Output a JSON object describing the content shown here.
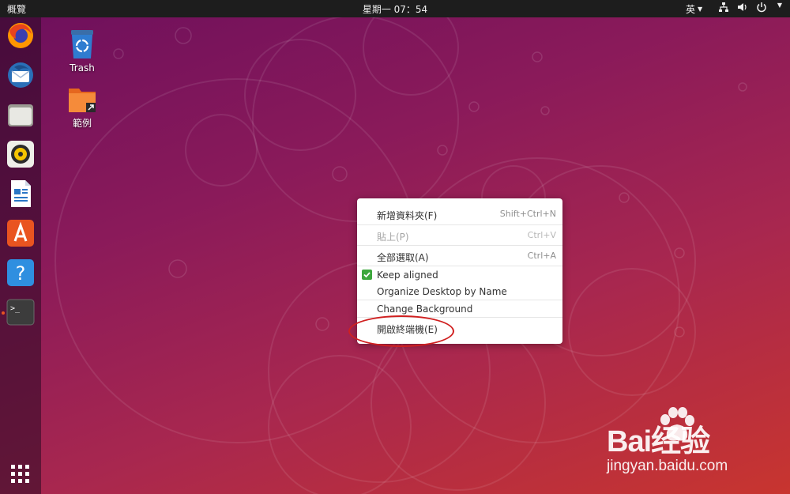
{
  "topbar": {
    "activities_label": "概覽",
    "clock": "星期一 07：54",
    "input_method": "英"
  },
  "dock": {
    "items": [
      {
        "icon": "firefox-icon"
      },
      {
        "icon": "thunderbird-icon"
      },
      {
        "icon": "files-icon"
      },
      {
        "icon": "rhythmbox-icon"
      },
      {
        "icon": "libreoffice-writer-icon"
      },
      {
        "icon": "ubuntu-software-icon"
      },
      {
        "icon": "help-icon"
      },
      {
        "icon": "terminal-icon",
        "running": true
      }
    ],
    "show_apps_icon": "app-grid-icon"
  },
  "desktop": {
    "icons": [
      {
        "label": "Trash",
        "icon": "trash-icon"
      },
      {
        "label": "範例",
        "icon": "folder-link-icon"
      }
    ]
  },
  "context_menu": {
    "items": [
      {
        "label": "新增資料夾(F)",
        "accel": "Shift+Ctrl+N",
        "enabled": true
      },
      {
        "label": "貼上(P)",
        "accel": "Ctrl+V",
        "enabled": false
      },
      {
        "label": "全部選取(A)",
        "accel": "Ctrl+A",
        "enabled": true
      },
      {
        "label": "Keep aligned",
        "checked": true,
        "enabled": true
      },
      {
        "label": "Organize Desktop by Name",
        "enabled": true
      },
      {
        "label": "Change Background",
        "enabled": true
      },
      {
        "label": "開啟終端機(E)",
        "enabled": true,
        "highlighted_by_annotation": true
      }
    ]
  },
  "watermark": {
    "brand": "Bai经验",
    "url": "jingyan.baidu.com"
  },
  "colors": {
    "accent": "#e95420",
    "annotation": "#d02020",
    "check": "#3da73d",
    "topbar": "#1d1d1d"
  }
}
